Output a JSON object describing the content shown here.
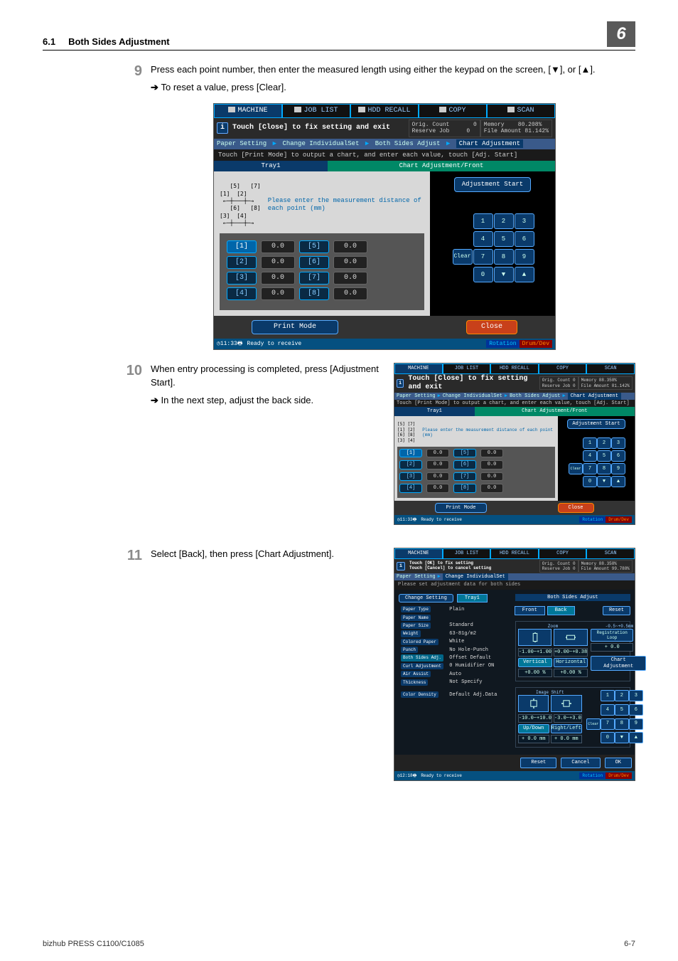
{
  "header": {
    "section_num": "6.1",
    "section_title": "Both Sides Adjustment",
    "chapter": "6"
  },
  "step9": {
    "num": "9",
    "text": "Press each point number, then enter the measured length using either the keypad on the screen, [▼], or [▲].",
    "sub": "To reset a value, press [Clear]."
  },
  "step10": {
    "num": "10",
    "text": "When entry processing is completed, press [Adjustment Start].",
    "sub": "In the next step, adjust the back side."
  },
  "step11": {
    "num": "11",
    "text": "Select [Back], then press [Chart Adjustment]."
  },
  "topnav": {
    "machine": "MACHINE",
    "joblist": "JOB LIST",
    "hdd": "HDD RECALL",
    "copy": "COPY",
    "scan": "SCAN"
  },
  "info": {
    "close_msg": "Touch [Close] to fix setting and exit",
    "orig_count_lbl": "Orig. Count",
    "orig_count_val": "0",
    "reserve_lbl": "Reserve Job",
    "reserve_val": "0",
    "memory_lbl": "Memory",
    "memory_val": "80.208%",
    "file_lbl": "File Amount",
    "file_val": "81.142%",
    "memory_val2": "88.358%",
    "file_val2": "81.142%",
    "memory_val3": "88.358%",
    "file_val3": "99.788%"
  },
  "crumb": {
    "paper_setting": "Paper Setting",
    "change_indiv": "Change IndividualSet",
    "both_sides": "Both Sides Adjust",
    "chart_adj": "Chart Adjustment"
  },
  "hint_text": "Touch [Print Mode] to output a chart, and enter each value, touch [Adj. Start]",
  "tray_tab1": "Tray1",
  "tray_tab2": "Chart Adjustment/Front",
  "schematic_msg": "Please enter the measurement distance of each point (mm)",
  "adjustment_start": "Adjustment Start",
  "points": {
    "rows": [
      {
        "a_label": "[1]",
        "a_val": "0.0",
        "b_label": "[5]",
        "b_val": "0.0",
        "a_sel": true
      },
      {
        "a_label": "[2]",
        "a_val": "0.0",
        "b_label": "[6]",
        "b_val": "0.0"
      },
      {
        "a_label": "[3]",
        "a_val": "0.0",
        "b_label": "[7]",
        "b_val": "0.0"
      },
      {
        "a_label": "[4]",
        "a_val": "0.0",
        "b_label": "[8]",
        "b_val": "0.0"
      }
    ]
  },
  "keypad": {
    "clear": "Clear",
    "keys": [
      "1",
      "2",
      "3",
      "4",
      "5",
      "6",
      "7",
      "8",
      "9",
      "0",
      "▼",
      "▲"
    ]
  },
  "foot": {
    "print_mode": "Print Mode",
    "close": "Close"
  },
  "status": {
    "time": "11:33",
    "ready": "Ready to receive",
    "rotation": "Rotation",
    "drum": "Drum/Dev"
  },
  "status2": {
    "time": "11:33"
  },
  "status3": {
    "time": "12:18"
  },
  "set": {
    "info1": "Touch [OK] to fix setting",
    "info2": "Touch [Cancel] to cancel setting",
    "hdr": "Please set adjustment data for both sides",
    "change_setting": "Change Setting",
    "tray": "Tray1",
    "bs_adjust": "Both Sides Adjust",
    "rows": [
      {
        "lbl": "Paper Type",
        "val": "Plain"
      },
      {
        "lbl": "Paper Name",
        "val": ""
      },
      {
        "lbl": "Paper Size",
        "val": "Standard"
      },
      {
        "lbl": "Weight",
        "val": "63-81g/m2"
      },
      {
        "lbl": "Colored Paper",
        "val": "White"
      },
      {
        "lbl": "Punch",
        "val": "No Hole-Punch"
      },
      {
        "lbl": "Both Sides Adj.",
        "val": "Offset Default"
      },
      {
        "lbl": "Curl Adjustment",
        "val": "0  Humidifier ON"
      },
      {
        "lbl": "Air Assist",
        "val": "Auto"
      },
      {
        "lbl": "Thickness",
        "val": "Not Specify"
      },
      {
        "lbl": "Color Density",
        "val": "Default Adj.Data"
      }
    ],
    "front": "Front",
    "back": "Back",
    "reset": "Reset",
    "zoom": "Zoom",
    "range1": "-0.5~+0.5mm",
    "registration": "Registration Loop",
    "reg_val": "+ 0.0",
    "vertical": "Vertical",
    "horizontal": "Horizontal",
    "v1": "-1.00~+1.00",
    "v2": "+0.00~+0.38",
    "pct": "+0.00  %",
    "pct2": "+0.00  %",
    "chart_adjustment": "Chart Adjustment",
    "image_shift": "Image Shift",
    "v3": "-10.0~+10.0",
    "v4": "-3.0~+3.0",
    "updown": "Up/Down",
    "rightleft": "Right/Left",
    "ud_val": "+ 0.0  mm",
    "rl_val": "+ 0.0  mm",
    "btn_reset": "Reset",
    "btn_cancel": "Cancel",
    "btn_ok": "OK"
  },
  "footer": {
    "model": "bizhub PRESS C1100/C1085",
    "page": "6-7"
  }
}
